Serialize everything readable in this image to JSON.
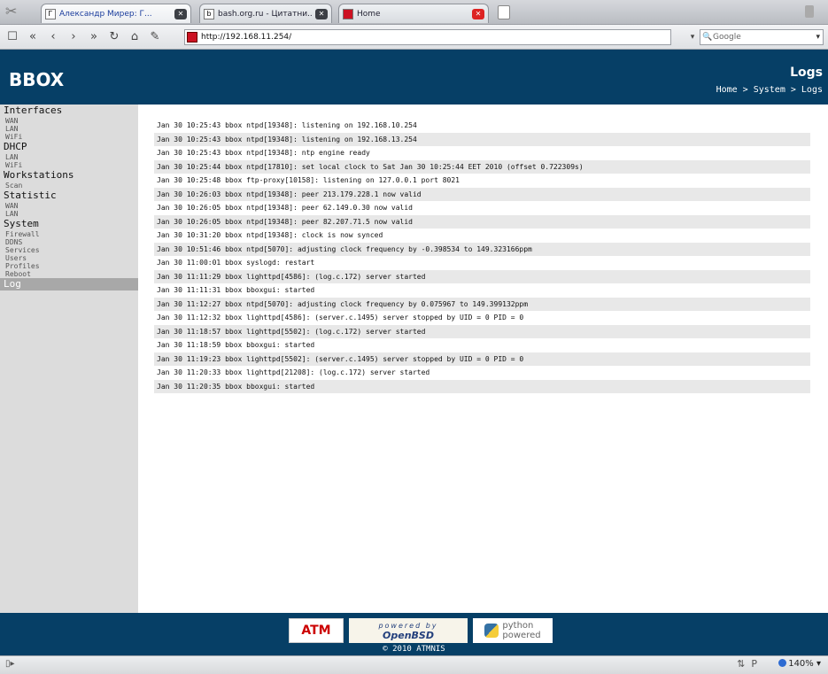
{
  "browser": {
    "tabs": [
      {
        "title": "Александр Мирер: Г...",
        "active": true
      },
      {
        "title": "bash.org.ru - Цитатни...",
        "active": false
      },
      {
        "title": "Home",
        "active": false
      }
    ],
    "address": "http://192.168.11.254/",
    "search_placeholder": "Google",
    "zoom": "140%"
  },
  "header": {
    "brand": "BBOX",
    "page_title": "Logs",
    "breadcrumb": "Home > System > Logs"
  },
  "sidebar": {
    "sections": [
      {
        "label": "Interfaces",
        "items": [
          "WAN",
          "LAN",
          "WiFi"
        ]
      },
      {
        "label": "DHCP",
        "items": [
          "LAN",
          "WiFi"
        ]
      },
      {
        "label": "Workstations",
        "items": [
          "Scan"
        ]
      },
      {
        "label": "Statistic",
        "items": [
          "WAN",
          "LAN"
        ]
      },
      {
        "label": "System",
        "items": [
          "Firewall",
          "DDNS",
          "Services",
          "Users",
          "Profiles",
          "Reboot"
        ]
      },
      {
        "label": "Log",
        "items": [],
        "active": true
      }
    ]
  },
  "logs": [
    "Jan 30 10:25:43 bbox ntpd[19348]: listening on 192.168.10.254",
    "Jan 30 10:25:43 bbox ntpd[19348]: listening on 192.168.13.254",
    "Jan 30 10:25:43 bbox ntpd[19348]: ntp engine ready",
    "Jan 30 10:25:44 bbox ntpd[17810]: set local clock to Sat Jan 30 10:25:44 EET 2010 (offset 0.722309s)",
    "Jan 30 10:25:48 bbox ftp-proxy[10158]: listening on 127.0.0.1 port 8021",
    "Jan 30 10:26:03 bbox ntpd[19348]: peer 213.179.228.1 now valid",
    "Jan 30 10:26:05 bbox ntpd[19348]: peer 62.149.0.30 now valid",
    "Jan 30 10:26:05 bbox ntpd[19348]: peer 82.207.71.5 now valid",
    "Jan 30 10:31:20 bbox ntpd[19348]: clock is now synced",
    "Jan 30 10:51:46 bbox ntpd[5070]: adjusting clock frequency by -0.398534 to 149.323166ppm",
    "Jan 30 11:00:01 bbox syslogd: restart",
    "Jan 30 11:11:29 bbox lighttpd[4586]: (log.c.172) server started",
    "Jan 30 11:11:31 bbox bboxgui: started",
    "Jan 30 11:12:27 bbox ntpd[5070]: adjusting clock frequency by 0.075967 to 149.399132ppm",
    "Jan 30 11:12:32 bbox lighttpd[4586]: (server.c.1495) server stopped by UID = 0 PID = 0",
    "Jan 30 11:18:57 bbox lighttpd[5502]: (log.c.172) server started",
    "Jan 30 11:18:59 bbox bboxgui: started",
    "Jan 30 11:19:23 bbox lighttpd[5502]: (server.c.1495) server stopped by UID = 0 PID = 0",
    "Jan 30 11:20:33 bbox lighttpd[21208]: (log.c.172) server started",
    "Jan 30 11:20:35 bbox bboxgui: started"
  ],
  "footer": {
    "badges": {
      "atm": "ATM",
      "openbsd_top": "powered by",
      "openbsd_main": "OpenBSD",
      "python_top": "python",
      "python_bottom": "powered"
    },
    "copyright": "© 2010 ATMNIS"
  },
  "colors": {
    "header_bg": "#063f66",
    "sidebar_bg": "#dcdcdc",
    "active_item": "#a8a8a8"
  }
}
